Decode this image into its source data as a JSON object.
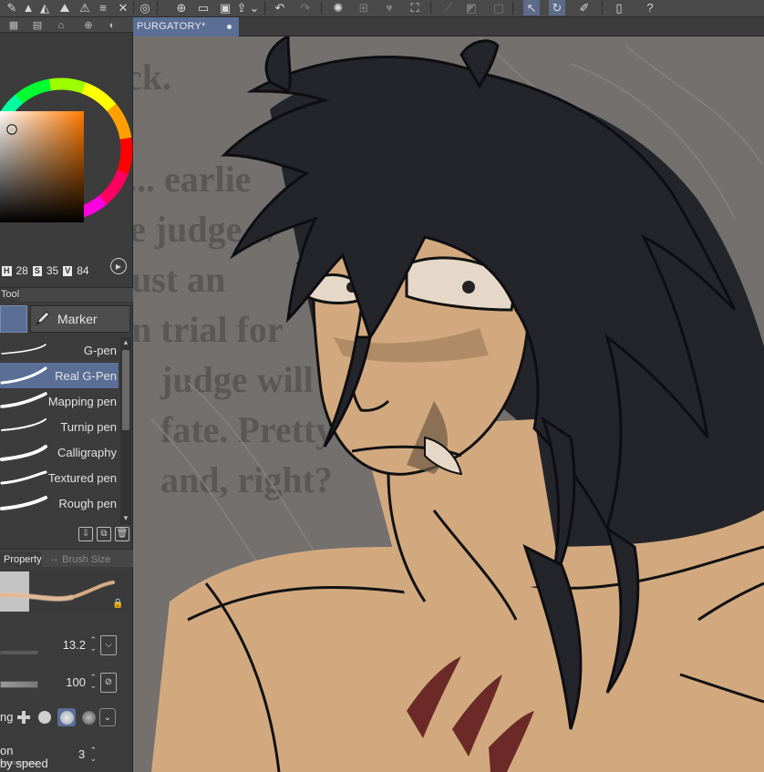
{
  "document": {
    "tab_title": "PURGATORY*"
  },
  "color_panel": {
    "hsv": {
      "h_label": "H",
      "h": "28",
      "s_label": "S",
      "s": "35",
      "v_label": "V",
      "v": "84"
    },
    "current_color": "#d6aa85"
  },
  "subtool": {
    "panel_label": "Tool",
    "group_name": "Marker",
    "brushes": [
      {
        "label": "G-pen"
      },
      {
        "label": "Real G-Pen"
      },
      {
        "label": "Mapping pen"
      },
      {
        "label": "Turnip pen"
      },
      {
        "label": "Calligraphy"
      },
      {
        "label": "Textured pen"
      },
      {
        "label": "Rough pen"
      }
    ],
    "selected_index": 1
  },
  "tool_property": {
    "tab_property": "Property",
    "tab_brush_size": "Brush Size",
    "brush_size_value": "13.2",
    "opacity_value": "100",
    "antialias_label": "ng",
    "stabilization_label": "on",
    "stabilization_value": "3",
    "by_speed_label": "by speed"
  },
  "colors": {
    "accent": "#5b6e96",
    "panel_bg": "#3c3c3c",
    "canvas_bg": "#6f6c6a"
  },
  "text_background": {
    "lines": [
      "ck.",
      "... earlie",
      "e judge w",
      "ust an",
      "n trial for",
      "judge will",
      "fate. Pretty",
      "and, right?"
    ]
  }
}
